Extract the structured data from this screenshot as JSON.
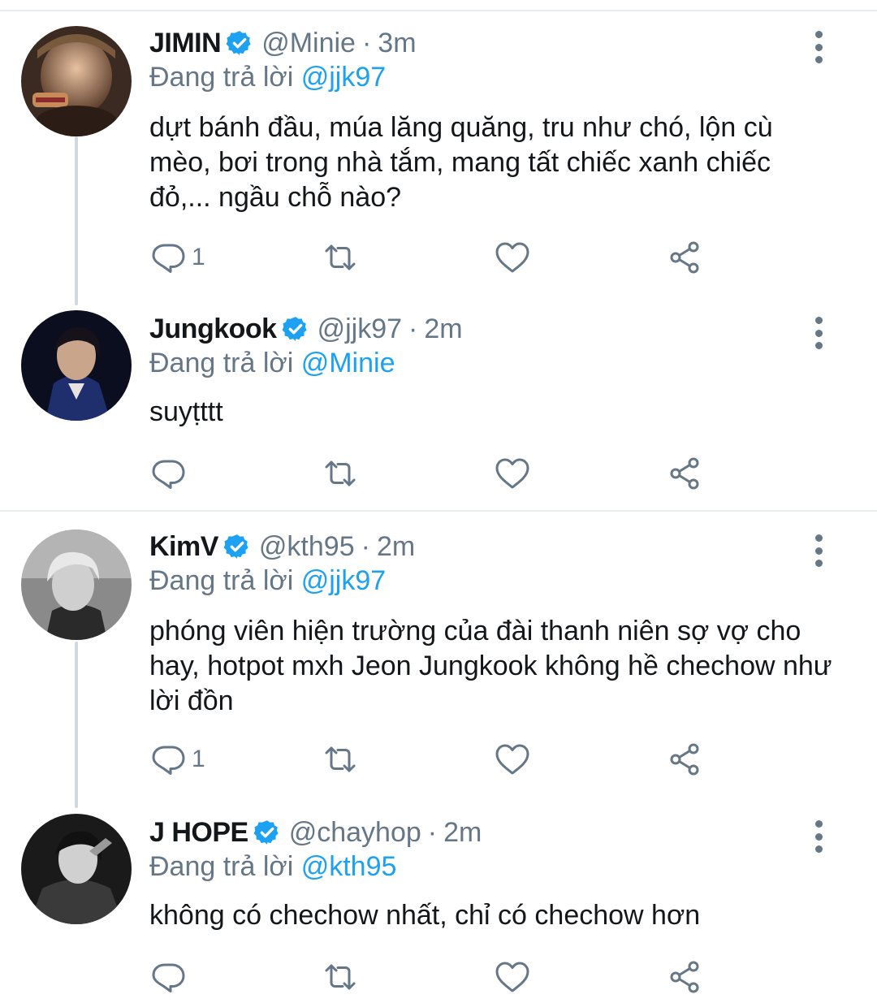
{
  "accent_color": "#1da1f2",
  "muted_color": "#657786",
  "tweets": [
    {
      "name": "JIMIN",
      "handle": "@Minie",
      "separator": "·",
      "time": "3m",
      "reply_prefix": "Đang trả lời",
      "reply_to": "@jjk97",
      "text": "dựt bánh đầu, múa lăng quăng, tru như chó, lộn cù mèo, bơi trong nhà tắm, mang tất chiếc xanh chiếc đỏ,... ngầu chỗ nào?",
      "reply_count": "1",
      "icons": [
        "verified-icon",
        "more-icon",
        "reply-icon",
        "retweet-icon",
        "like-icon",
        "share-icon"
      ]
    },
    {
      "name": "Jungkook",
      "handle": "@jjk97",
      "separator": "·",
      "time": "2m",
      "reply_prefix": "Đang trả lời",
      "reply_to": "@Minie",
      "text": "suyṭttt",
      "reply_count": "",
      "icons": [
        "verified-icon",
        "more-icon",
        "reply-icon",
        "retweet-icon",
        "like-icon",
        "share-icon"
      ]
    },
    {
      "name": "KimV",
      "handle": "@kth95",
      "separator": "·",
      "time": "2m",
      "reply_prefix": "Đang trả lời",
      "reply_to": "@jjk97",
      "text": "phóng viên hiện trường của đài thanh niên sợ vợ cho hay, hotpot mxh Jeon Jungkook không hề chechow như lời đồn",
      "reply_count": "1",
      "icons": [
        "verified-icon",
        "more-icon",
        "reply-icon",
        "retweet-icon",
        "like-icon",
        "share-icon"
      ]
    },
    {
      "name": "J HOPE",
      "handle": "@chayhop",
      "separator": "·",
      "time": "2m",
      "reply_prefix": "Đang trả lời",
      "reply_to": "@kth95",
      "text": "không có chechow nhất, chỉ có chechow hơn",
      "reply_count": "",
      "icons": [
        "verified-icon",
        "more-icon",
        "reply-icon",
        "retweet-icon",
        "like-icon",
        "share-icon"
      ]
    }
  ]
}
